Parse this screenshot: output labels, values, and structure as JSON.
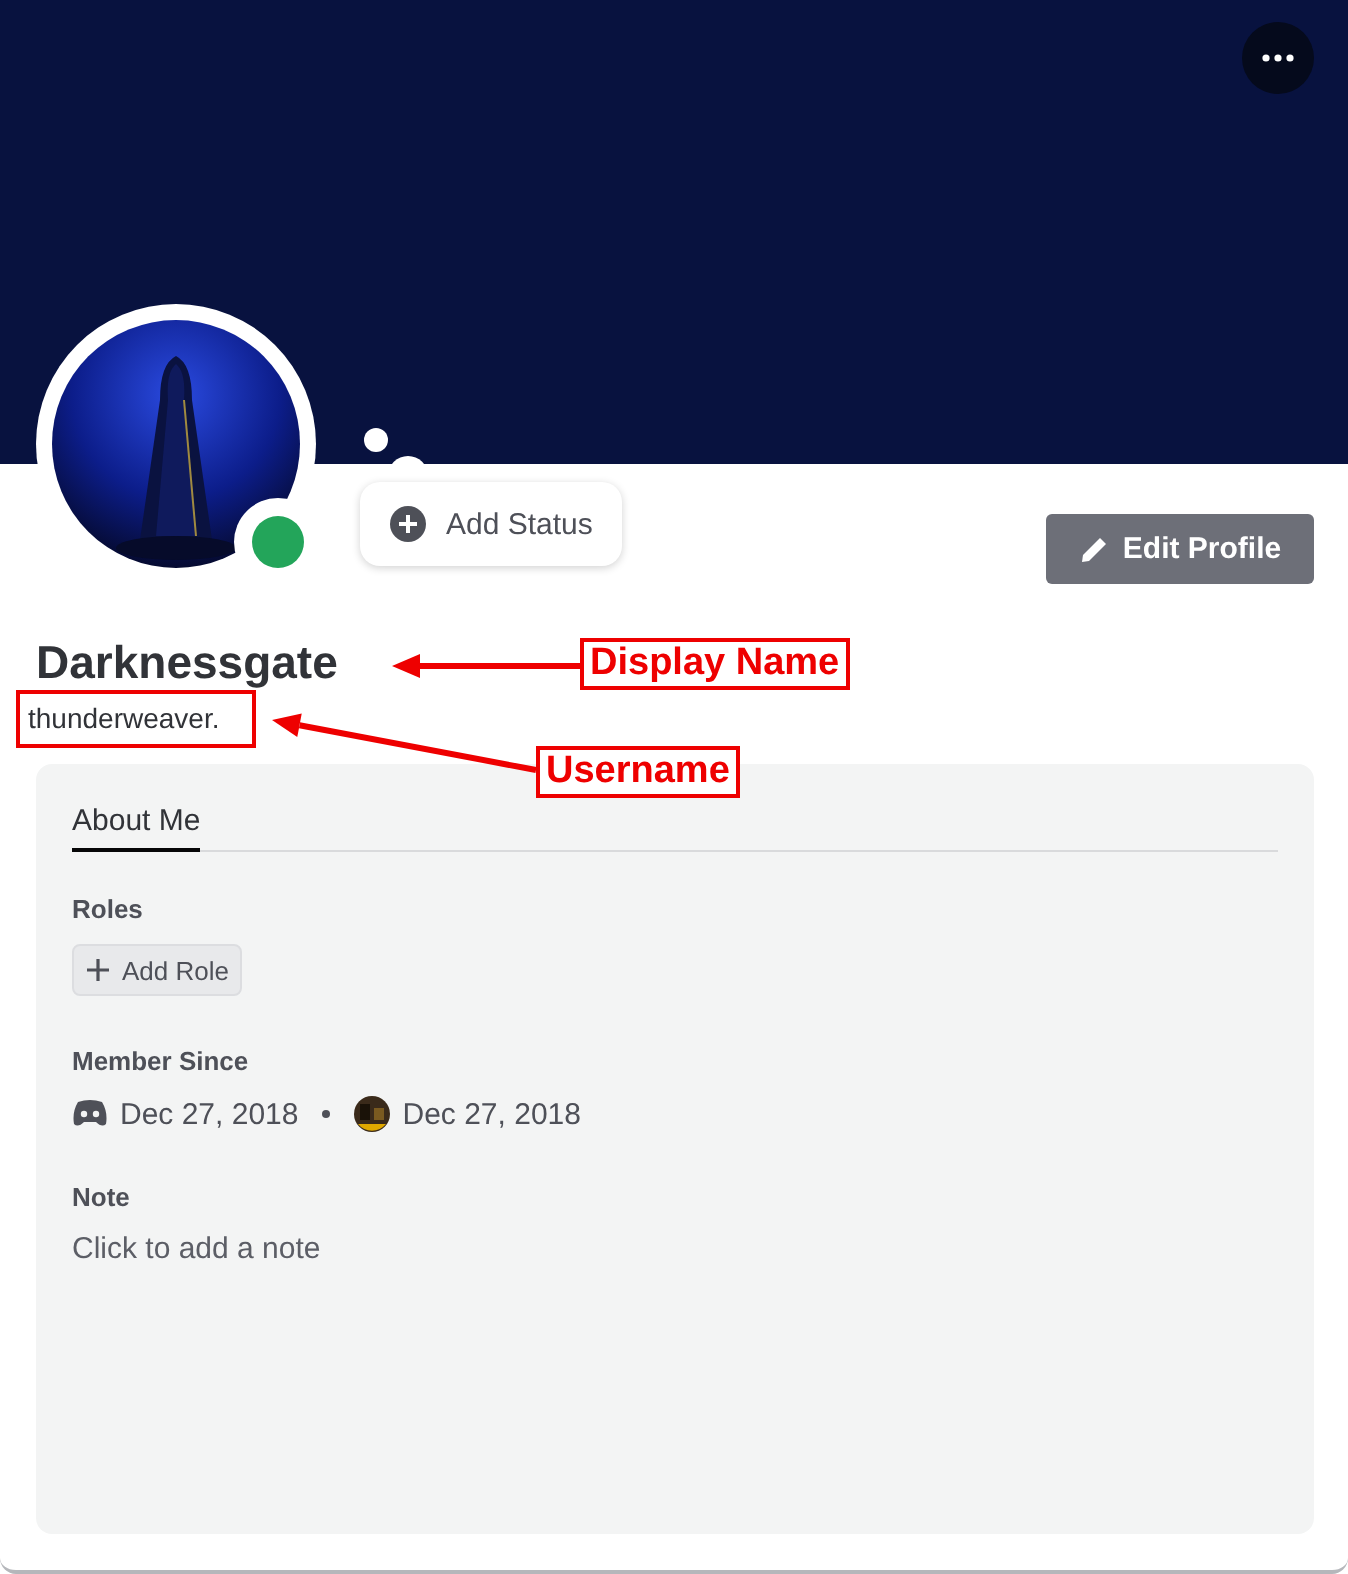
{
  "profile": {
    "display_name": "Darknessgate",
    "username": "thunderweaver.",
    "status_dot": {
      "color": "#23a55a"
    },
    "add_status": "Add Status",
    "edit_button": "Edit Profile"
  },
  "tabs": [
    {
      "label": "About Me",
      "selected": true
    }
  ],
  "roles": {
    "title": "Roles",
    "add_button": "Add Role"
  },
  "member_since": {
    "title": "Member Since",
    "entries": [
      {
        "kind": "app",
        "date": "Dec 27, 2018"
      },
      {
        "kind": "server",
        "date": "Dec 27, 2018"
      }
    ]
  },
  "note": {
    "title": "Note",
    "placeholder": "Click to add a note"
  },
  "annotations": [
    {
      "kind": "display-name",
      "label": "Display Name"
    },
    {
      "kind": "username",
      "label": "Username"
    }
  ]
}
